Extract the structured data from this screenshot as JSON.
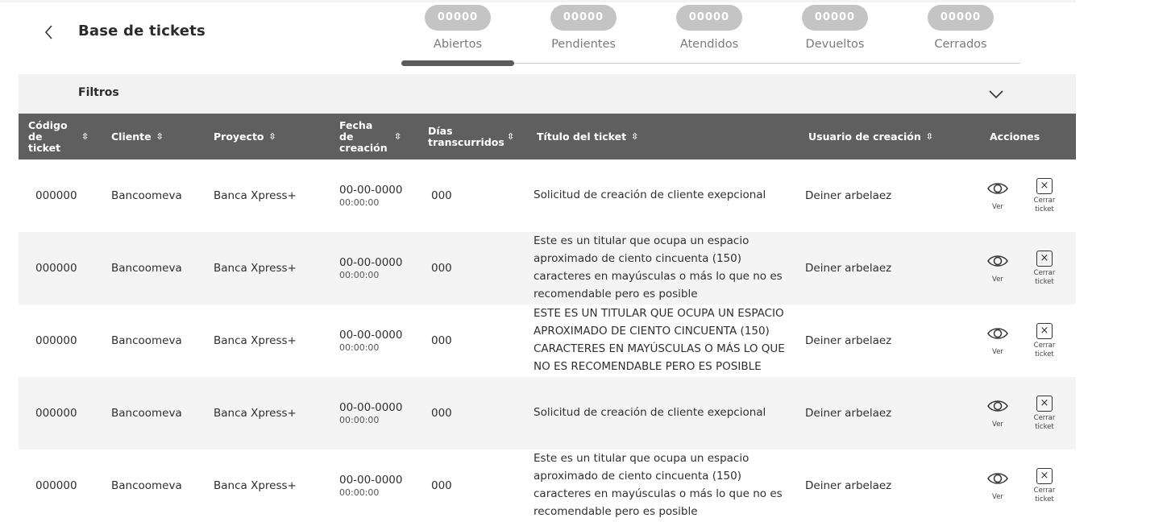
{
  "header": {
    "title": "Base de tickets"
  },
  "tabs": [
    {
      "count": "00000",
      "label": "Abiertos",
      "active": true
    },
    {
      "count": "00000",
      "label": "Pendientes",
      "active": false
    },
    {
      "count": "00000",
      "label": "Atendidos",
      "active": false
    },
    {
      "count": "00000",
      "label": "Devueltos",
      "active": false
    },
    {
      "count": "00000",
      "label": "Cerrados",
      "active": false
    }
  ],
  "filters": {
    "label": "Filtros"
  },
  "table": {
    "columns": [
      {
        "label": "Código de ticket",
        "sortable": true
      },
      {
        "label": "Cliente",
        "sortable": true
      },
      {
        "label": "Proyecto",
        "sortable": true
      },
      {
        "label": "Fecha de creación",
        "sortable": true
      },
      {
        "label": "Días transcurridos",
        "sortable": true
      },
      {
        "label": "Título del ticket",
        "sortable": true
      },
      {
        "label": "Usuario de creación",
        "sortable": true
      },
      {
        "label": "Acciones",
        "sortable": false
      }
    ],
    "sort_icon": "⇳",
    "actions": {
      "view_label": "Ver",
      "close_label_line1": "Cerrar",
      "close_label_line2": "ticket"
    },
    "rows": [
      {
        "code": "000000",
        "client": "Bancoomeva",
        "project": "Banca Xpress+",
        "date": "00-00-0000",
        "time": "00:00:00",
        "days": "000",
        "title": "Solicitud de creación de cliente exepcional",
        "user": "Deiner arbelaez"
      },
      {
        "code": "000000",
        "client": "Bancoomeva",
        "project": "Banca Xpress+",
        "date": "00-00-0000",
        "time": "00:00:00",
        "days": "000",
        "title": "Este es un titular que ocupa un espacio aproximado de ciento cincuenta (150) caracteres en mayúsculas o más lo que no es recomendable pero es posible",
        "user": "Deiner arbelaez"
      },
      {
        "code": "000000",
        "client": "Bancoomeva",
        "project": "Banca Xpress+",
        "date": "00-00-0000",
        "time": "00:00:00",
        "days": "000",
        "title": "ESTE ES UN TITULAR QUE OCUPA UN ESPACIO APROXIMADO DE CIENTO CINCUENTA (150) CARACTERES EN MAYÚSCULAS O MÁS LO QUE NO ES RECOMENDABLE PERO ES POSIBLE",
        "user": "Deiner arbelaez"
      },
      {
        "code": "000000",
        "client": "Bancoomeva",
        "project": "Banca Xpress+",
        "date": "00-00-0000",
        "time": "00:00:00",
        "days": "000",
        "title": "Solicitud de creación de cliente exepcional",
        "user": "Deiner arbelaez"
      },
      {
        "code": "000000",
        "client": "Bancoomeva",
        "project": "Banca Xpress+",
        "date": "00-00-0000",
        "time": "00:00:00",
        "days": "000",
        "title": "Este es un titular que ocupa un espacio aproximado de ciento cincuenta (150) caracteres en mayúsculas o más lo que no es recomendable pero es posible",
        "user": "Deiner arbelaez"
      }
    ]
  }
}
